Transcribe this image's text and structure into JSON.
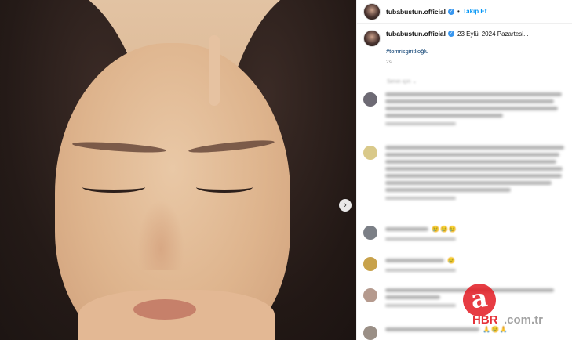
{
  "post": {
    "username": "tubabustun.official",
    "follow_label": "Takip Et",
    "date_text": "23 Eylül 2024 Pazartesi...",
    "hashtag": "#tomrisgiritlioğlu",
    "age": "2s",
    "nav_arrow": "›",
    "verified_mark": "✓",
    "separator": "•"
  },
  "comments": {
    "sort_label": "Senin için ⌄",
    "emoji_row_1": "😢😢😢",
    "emoji_row_2": "😢",
    "emoji_row_3": "🙏😢🙏"
  },
  "watermark": {
    "logo_letter": "a",
    "brand": "HBR",
    "domain": ".com.tr"
  },
  "colors": {
    "accent": "#0095f6",
    "hashtag": "#00376b",
    "verified": "#3897f0",
    "watermark_red": "#e31b23"
  }
}
